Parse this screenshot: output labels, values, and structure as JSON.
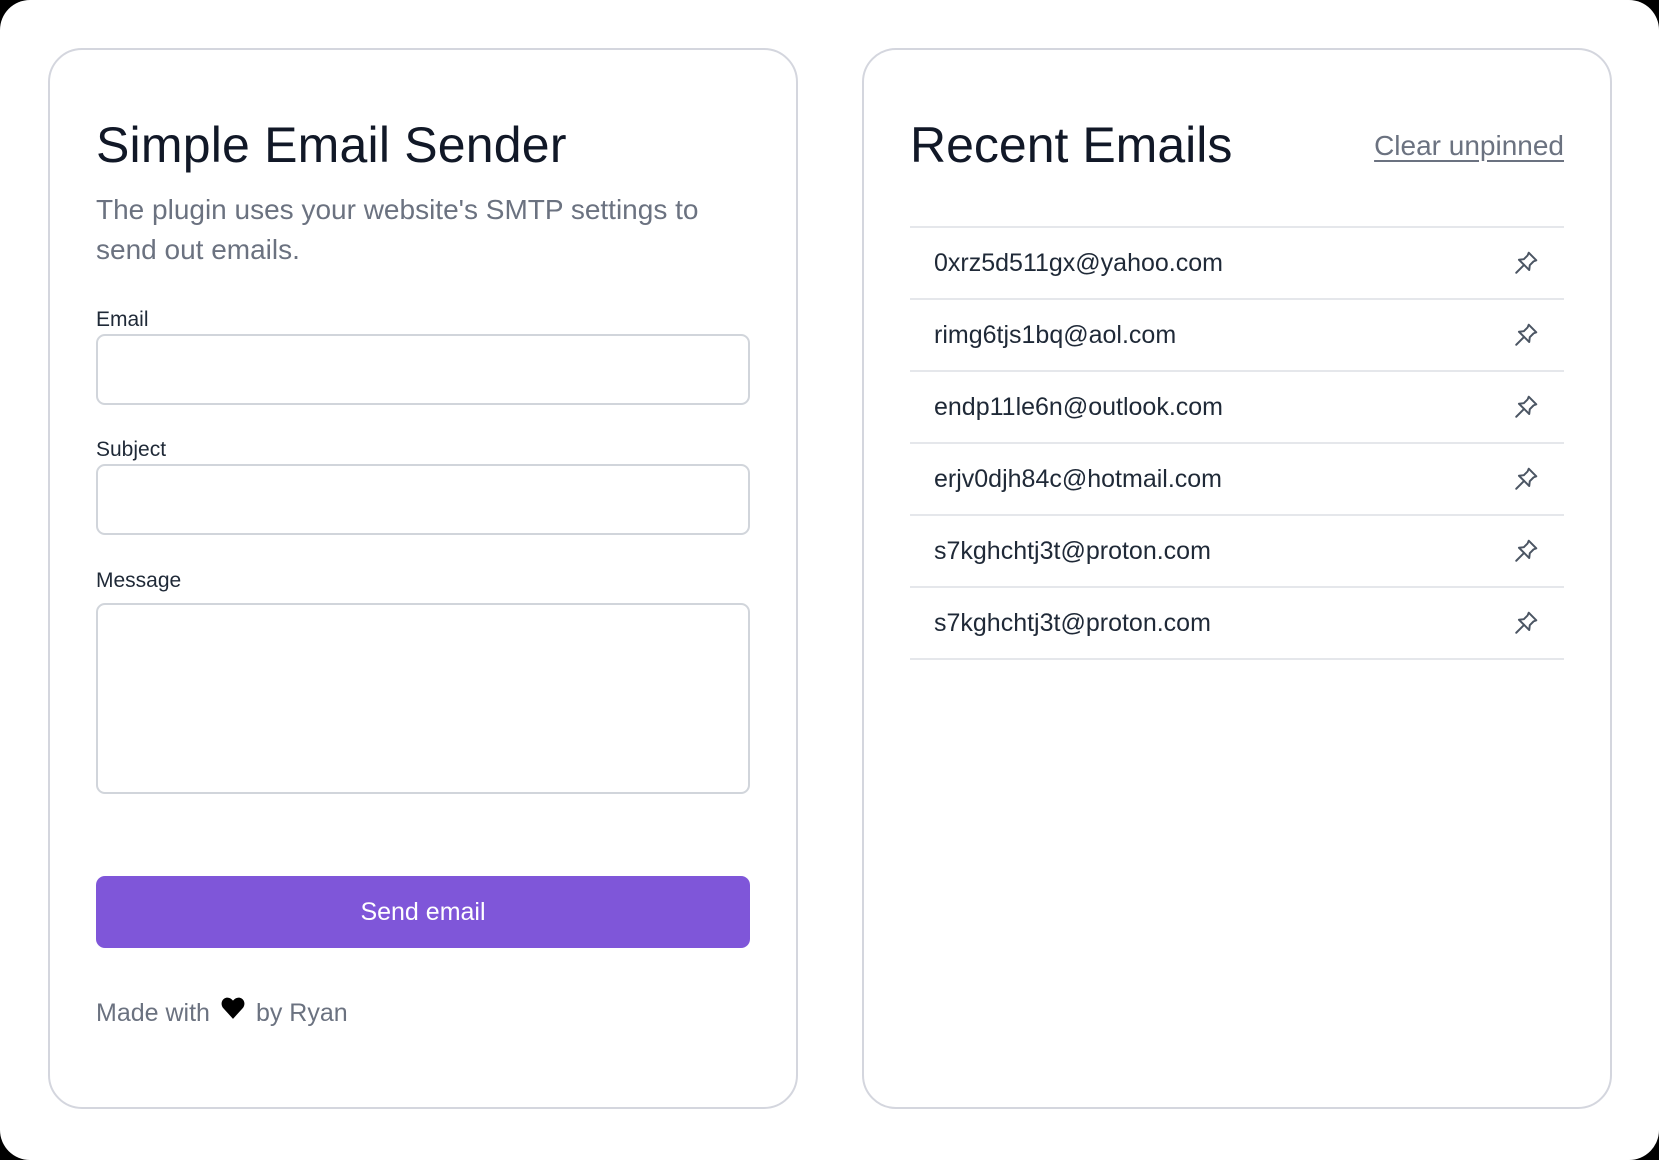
{
  "sender": {
    "title": "Simple Email Sender",
    "subtitle": "The plugin uses your website's SMTP settings to send out emails.",
    "fields": {
      "email": {
        "label": "Email",
        "value": "",
        "placeholder": ""
      },
      "subject": {
        "label": "Subject",
        "value": "",
        "placeholder": ""
      },
      "message": {
        "label": "Message",
        "value": "",
        "placeholder": ""
      }
    },
    "send_label": "Send email",
    "footer": {
      "prefix": "Made with",
      "icon": "heart-icon",
      "suffix": "by Ryan"
    }
  },
  "recent": {
    "title": "Recent Emails",
    "clear_label": "Clear unpinned",
    "pin_icon": "pin-icon",
    "emails": [
      "0xrz5d511gx@yahoo.com",
      "rimg6tjs1bq@aol.com",
      "endp11le6n@outlook.com",
      "erjv0djh84c@hotmail.com",
      "s7kghchtj3t@proton.com",
      "s7kghchtj3t@proton.com"
    ]
  },
  "colors": {
    "accent": "#7f56d9",
    "text_primary": "#111827",
    "text_muted": "#6b7280",
    "border": "#d4d6de"
  }
}
